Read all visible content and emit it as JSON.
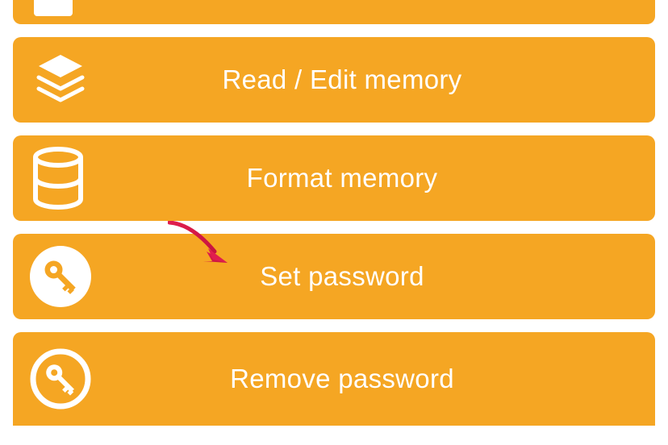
{
  "menu": {
    "items": [
      {
        "label": ""
      },
      {
        "label": "Read / Edit memory"
      },
      {
        "label": "Format memory"
      },
      {
        "label": "Set password"
      },
      {
        "label": "Remove password"
      }
    ]
  },
  "annotation": {
    "description": "red arrow pointing at Set password"
  },
  "colors": {
    "button": "#f5a623",
    "text": "#ffffff",
    "arrow": "#e01e4e"
  }
}
